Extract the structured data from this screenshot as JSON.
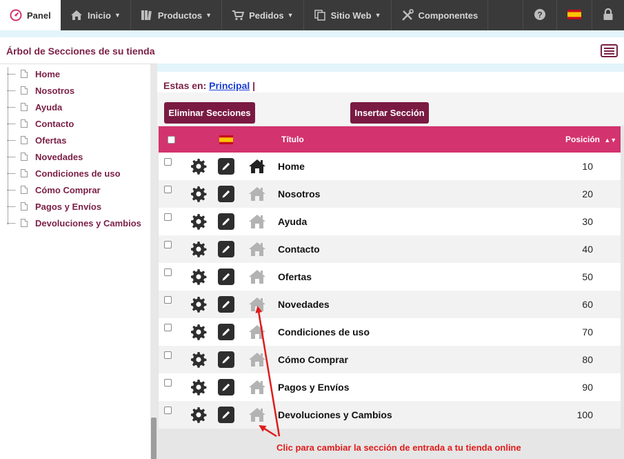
{
  "nav": {
    "panel": "Panel",
    "inicio": "Inicio",
    "productos": "Productos",
    "pedidos": "Pedidos",
    "sitio_web": "Sitio Web",
    "componentes": "Componentes",
    "icons": [
      "dashboard-icon",
      "home-icon",
      "books-icon",
      "cart-icon",
      "copy-icon",
      "tools-icon",
      "help-icon",
      "spain-flag-icon",
      "lock-icon"
    ]
  },
  "header": {
    "title": "Árbol de Secciones de su tienda"
  },
  "sidebar": {
    "items": [
      {
        "label": "Home"
      },
      {
        "label": "Nosotros"
      },
      {
        "label": "Ayuda"
      },
      {
        "label": "Contacto"
      },
      {
        "label": "Ofertas"
      },
      {
        "label": "Novedades"
      },
      {
        "label": "Condiciones de uso"
      },
      {
        "label": "Cómo Comprar"
      },
      {
        "label": "Pagos y Envíos"
      },
      {
        "label": "Devoluciones y Cambios"
      }
    ]
  },
  "breadcrumb": {
    "prefix": "Estas en:",
    "link": "Principal",
    "sep": "|"
  },
  "actions": {
    "delete_label": "Eliminar Secciones",
    "insert_label": "Insertar Sección"
  },
  "table": {
    "headers": {
      "title": "Título",
      "position": "Posición"
    },
    "rows": [
      {
        "title": "Home",
        "position": "10",
        "is_home": true
      },
      {
        "title": "Nosotros",
        "position": "20",
        "is_home": false
      },
      {
        "title": "Ayuda",
        "position": "30",
        "is_home": false
      },
      {
        "title": "Contacto",
        "position": "40",
        "is_home": false
      },
      {
        "title": "Ofertas",
        "position": "50",
        "is_home": false
      },
      {
        "title": "Novedades",
        "position": "60",
        "is_home": false
      },
      {
        "title": "Condiciones de uso",
        "position": "70",
        "is_home": false
      },
      {
        "title": "Cómo Comprar",
        "position": "80",
        "is_home": false
      },
      {
        "title": "Pagos y Envíos",
        "position": "90",
        "is_home": false
      },
      {
        "title": "Devoluciones y Cambios",
        "position": "100",
        "is_home": false
      }
    ]
  },
  "annotation": {
    "text": "Clic para cambiar la sección de entrada a tu tienda online"
  },
  "colors": {
    "brand": "#7a1f45",
    "table_header": "#d3336e",
    "annotation": "#e01b1b",
    "nav_bg": "#3a3a3a"
  }
}
